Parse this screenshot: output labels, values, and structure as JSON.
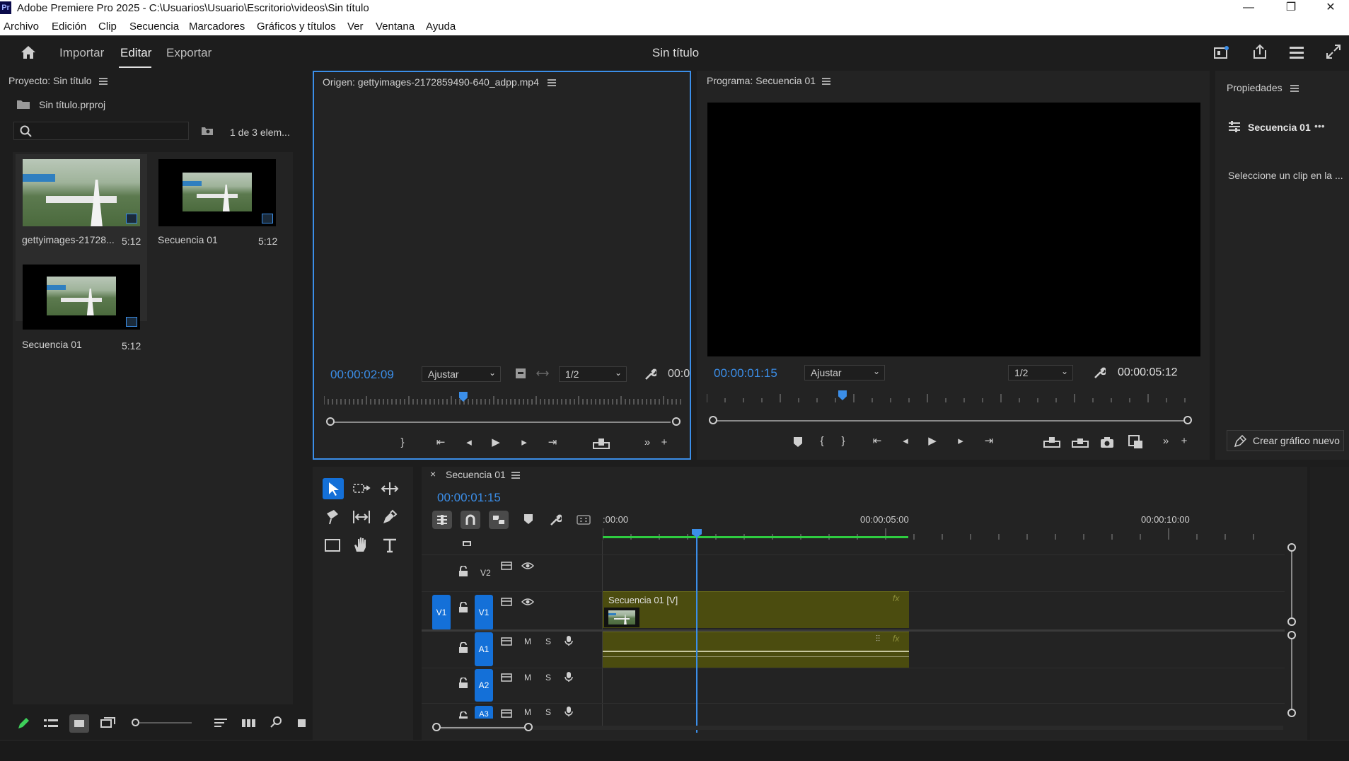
{
  "titlebar": {
    "logo": "Pr",
    "title": "Adobe Premiere Pro 2025 - C:\\Usuarios\\Usuario\\Escritorio\\videos\\Sin título",
    "minimize": "—",
    "maximize": "❐",
    "close": "✕"
  },
  "menubar": {
    "items": [
      "Archivo",
      "Edición",
      "Clip",
      "Secuencia",
      "Marcadores",
      "Gráficos y títulos",
      "Ver",
      "Ventana",
      "Ayuda"
    ]
  },
  "header": {
    "home_icon": "home-icon",
    "nav": [
      "Importar",
      "Editar",
      "Exportar"
    ],
    "active": "Editar",
    "project_title": "Sin título"
  },
  "project_panel": {
    "title": "Proyecto: Sin título",
    "file": "Sin título.prproj",
    "search_placeholder": "",
    "count": "1 de 3 elem...",
    "items": [
      {
        "name": "gettyimages-21728...",
        "duration": "5:12",
        "kind": "video"
      },
      {
        "name": "Secuencia 01",
        "duration": "5:12",
        "kind": "sequence"
      },
      {
        "name": "Secuencia 01",
        "duration": "5:12",
        "kind": "sequence"
      }
    ]
  },
  "source_monitor": {
    "title": "Origen: gettyimages-2172859490-640_adpp.mp4",
    "timecode": "00:00:02:09",
    "fit": "Ajustar",
    "resolution": "1/2",
    "duration_partial": "00:0",
    "playhead_fraction": 0.41
  },
  "program_monitor": {
    "title": "Programa: Secuencia 01",
    "timecode": "00:00:01:15",
    "fit": "Ajustar",
    "resolution": "1/2",
    "duration": "00:00:05:12",
    "playhead_fraction": 0.29
  },
  "properties_panel": {
    "title": "Propiedades",
    "sequence_name": "Secuencia 01",
    "more": "•••",
    "hint": "Seleccione un clip en la ...",
    "create_button": "Crear gráfico nuevo"
  },
  "timeline": {
    "tab_close": "×",
    "sequence": "Secuencia 01",
    "timecode": "00:00:01:15",
    "ruler_labels": [
      ":00:00",
      "00:00:05:00",
      "00:00:10:00"
    ],
    "video_tracks": [
      {
        "target": "",
        "name": "V2"
      },
      {
        "target": "V1",
        "name": "V1"
      }
    ],
    "audio_tracks": [
      {
        "name": "A1",
        "mute": "M",
        "solo": "S"
      },
      {
        "name": "A2",
        "mute": "M",
        "solo": "S"
      },
      {
        "name": "A3",
        "mute": "M",
        "solo": "S"
      }
    ],
    "video_clip_label": "Secuencia 01 [V]",
    "fx_label": "fx"
  },
  "colors": {
    "accent": "#3b8ee8",
    "track_target": "#1470d8",
    "clip": "#4b4c0f",
    "work_area": "#2ecc40"
  }
}
